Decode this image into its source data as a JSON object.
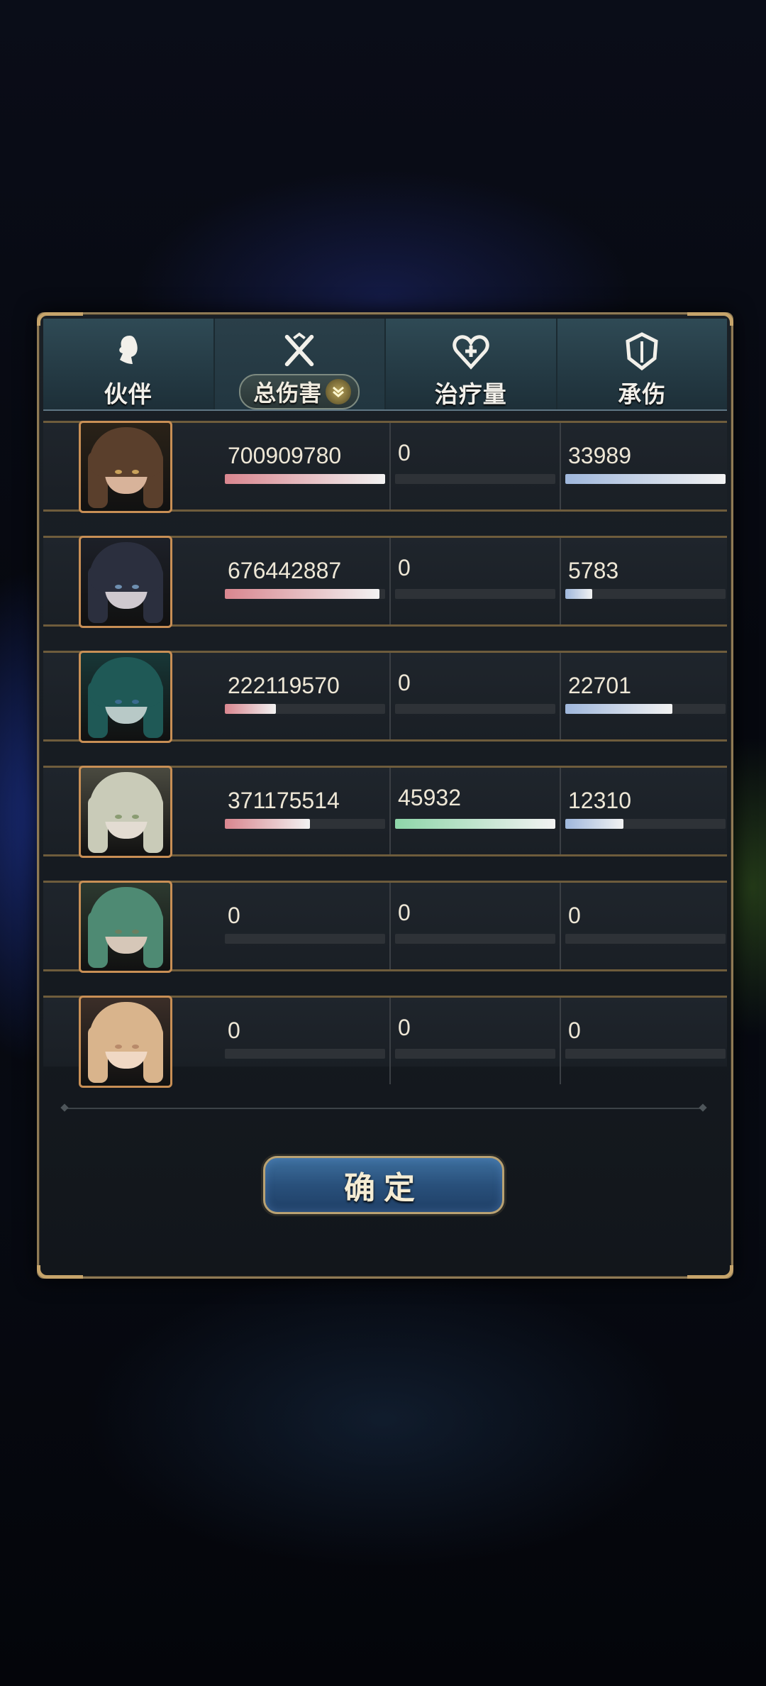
{
  "header": {
    "partner_label": "伙伴",
    "damage_label": "总伤害",
    "heal_label": "治疗量",
    "taken_label": "承伤"
  },
  "colors": {
    "damage_bar": "#d9868f",
    "heal_bar": "#8ed6a9",
    "taken_bar": "#9fb7dc",
    "border_gold": "#c88f55"
  },
  "rows": [
    {
      "avatar": "brown-hair-portrait",
      "damage": "700909780",
      "heal": "0",
      "taken": "33989",
      "damage_pct": 1.0,
      "heal_pct": 0,
      "taken_pct": 1.0
    },
    {
      "avatar": "dark-hair-portrait",
      "damage": "676442887",
      "heal": "0",
      "taken": "5783",
      "damage_pct": 0.965,
      "heal_pct": 0,
      "taken_pct": 0.17
    },
    {
      "avatar": "teal-hair-portrait",
      "damage": "222119570",
      "heal": "0",
      "taken": "22701",
      "damage_pct": 0.317,
      "heal_pct": 0,
      "taken_pct": 0.668
    },
    {
      "avatar": "white-hair-portrait",
      "damage": "371175514",
      "heal": "45932",
      "taken": "12310",
      "damage_pct": 0.53,
      "heal_pct": 1.0,
      "taken_pct": 0.362
    },
    {
      "avatar": "green-hair-portrait",
      "damage": "0",
      "heal": "0",
      "taken": "0",
      "damage_pct": 0,
      "heal_pct": 0,
      "taken_pct": 0
    },
    {
      "avatar": "blonde-hair-portrait",
      "damage": "0",
      "heal": "0",
      "taken": "0",
      "damage_pct": 0,
      "heal_pct": 0,
      "taken_pct": 0
    }
  ],
  "confirm_label": "确定"
}
